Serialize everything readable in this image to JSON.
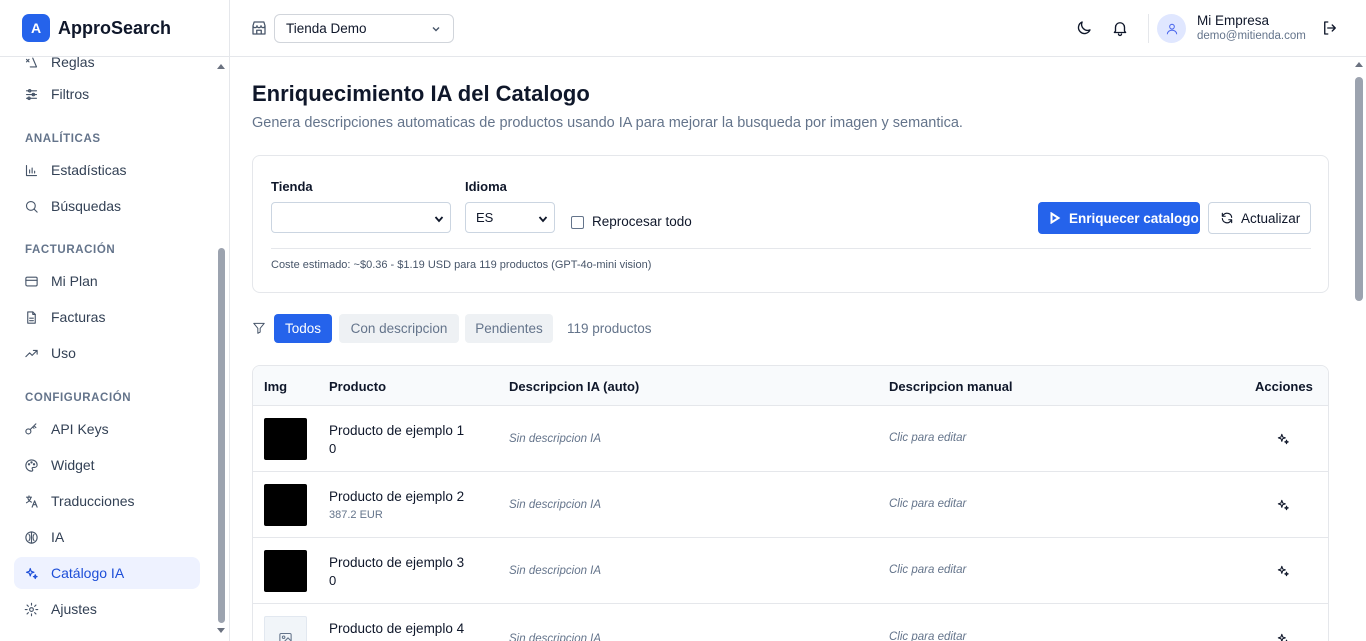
{
  "brand": {
    "logo_letter": "A",
    "name": "ApproSearch"
  },
  "sidebar": {
    "items": [
      {
        "label": "Reglas",
        "icon": "rules-icon"
      },
      {
        "label": "Filtros",
        "icon": "sliders-icon"
      },
      {
        "label": "Estadísticas",
        "icon": "bar-chart-icon"
      },
      {
        "label": "Búsquedas",
        "icon": "search-icon"
      },
      {
        "label": "Mi Plan",
        "icon": "credit-card-icon"
      },
      {
        "label": "Facturas",
        "icon": "file-text-icon"
      },
      {
        "label": "Uso",
        "icon": "trending-up-icon"
      },
      {
        "label": "API Keys",
        "icon": "key-icon"
      },
      {
        "label": "Widget",
        "icon": "palette-icon"
      },
      {
        "label": "Traducciones",
        "icon": "languages-icon"
      },
      {
        "label": "IA",
        "icon": "brain-icon"
      },
      {
        "label": "Catálogo IA",
        "icon": "sparkles-icon",
        "active": true
      },
      {
        "label": "Ajustes",
        "icon": "gear-icon"
      }
    ],
    "sections": [
      "ANALÍTICAS",
      "FACTURACIÓN",
      "CONFIGURACIÓN"
    ]
  },
  "header": {
    "store_select": "Tienda Demo",
    "user_name": "Mi Empresa",
    "user_email": "demo@mitienda.com"
  },
  "page": {
    "title": "Enriquecimiento IA del Catalogo",
    "subtitle": "Genera descripciones automaticas de productos usando IA para mejorar la busqueda por imagen y semantica."
  },
  "controls": {
    "store_label": "Tienda",
    "store_value": "",
    "language_label": "Idioma",
    "language_value": "ES",
    "reprocess_label": "Reprocesar todo",
    "reprocess_checked": false,
    "enrich_button": "Enriquecer catalogo",
    "refresh_button": "Actualizar",
    "cost_note": "Coste estimado: ~$0.36 - $1.19 USD para 119 productos (GPT-4o-mini vision)"
  },
  "filters": {
    "chips": [
      "Todos",
      "Con descripcion",
      "Pendientes"
    ],
    "active": "Todos",
    "count": "119 productos"
  },
  "table": {
    "headers": [
      "Img",
      "Producto",
      "Descripcion IA (auto)",
      "Descripcion manual",
      "Acciones"
    ],
    "rows": [
      {
        "name": "Producto de ejemplo 1",
        "price": "0",
        "ai": "Sin descripcion IA",
        "manual": "Clic para editar",
        "image": "black"
      },
      {
        "name": "Producto de ejemplo 2",
        "price": "387.2 EUR",
        "ai": "Sin descripcion IA",
        "manual": "Clic para editar",
        "image": "black"
      },
      {
        "name": "Producto de ejemplo 3",
        "price": "0",
        "ai": "Sin descripcion IA",
        "manual": "Clic para editar",
        "image": "black"
      },
      {
        "name": "Producto de ejemplo 4",
        "price": "",
        "ai": "Sin descripcion IA",
        "manual": "Clic para editar",
        "image": "placeholder"
      }
    ]
  },
  "colors": {
    "accent": "#2563eb",
    "active_bg": "#eef2ff",
    "border": "#e5e7eb"
  }
}
